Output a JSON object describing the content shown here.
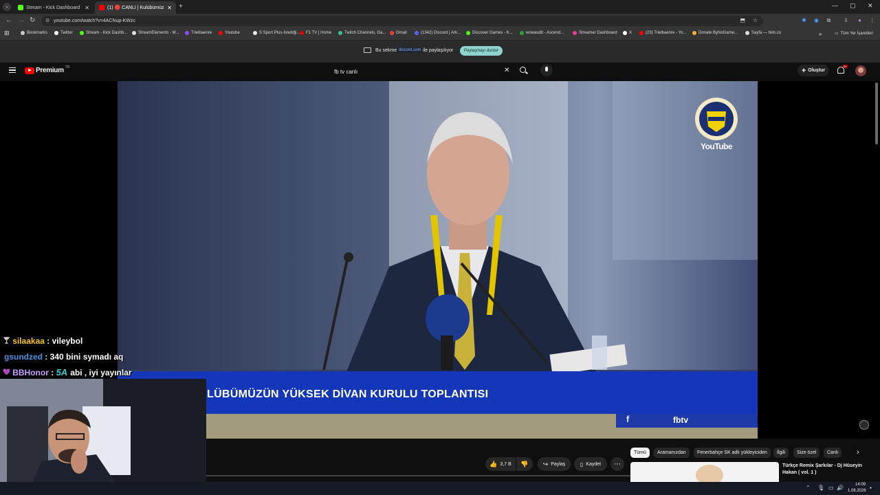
{
  "browser": {
    "tabs": [
      {
        "title": "Stream - Kick Dashboard",
        "active": false,
        "favicon_color": "#53fc18"
      },
      {
        "title": "(1) 🔴 CANLI | Kulübümüzü…",
        "active": true,
        "favicon_color": "#ff0000"
      }
    ],
    "new_tab_label": "+",
    "url": "youtube.com/watch?v=4ACNup-KWzc",
    "bookmarks": [
      {
        "label": "Bookmarks",
        "color": "#cccccc"
      },
      {
        "label": "Twitter",
        "color": "#ffffff"
      },
      {
        "label": "Stream - Kick Dashb...",
        "color": "#53fc18"
      },
      {
        "label": "StreamElements - M...",
        "color": "#dddddd"
      },
      {
        "label": "Trielbaenre",
        "color": "#9146ff"
      },
      {
        "label": "Youtube",
        "color": "#ff0000"
      },
      {
        "label": "S Sport Plus-İstediği...",
        "color": "#e8e8e8"
      },
      {
        "label": "F1 TV | Home",
        "color": "#e10600"
      },
      {
        "label": "Twitch Channels, Ga...",
        "color": "#3dbb9c"
      },
      {
        "label": "Gmail",
        "color": "#ea4335"
      },
      {
        "label": "(1342) Discord | Ark...",
        "color": "#5865f2"
      },
      {
        "label": "Discover Games - K...",
        "color": "#53fc18"
      },
      {
        "label": "wowaudit - Ascend...",
        "color": "#2ea043"
      },
      {
        "label": "Streamer Dashboard",
        "color": "#e040a0"
      },
      {
        "label": "X",
        "color": "#ffffff"
      },
      {
        "label": "(23) Trielbaenre - Yo...",
        "color": "#ff0000"
      },
      {
        "label": "Donate ByNoGame...",
        "color": "#f5b041"
      },
      {
        "label": "Sayfa — hiits.co",
        "color": "#dddddd"
      }
    ],
    "all_bookmarks_label": "Tüm Yer İşaretleri",
    "share_bar": {
      "prefix": "Bu sekme",
      "site": "discord.com",
      "suffix": "ile paylaşılıyor",
      "stop_button": "Paylaşmayı durdur"
    }
  },
  "youtube": {
    "brand": "Premium",
    "brand_sup": "TR",
    "search_query": "fb tv canlı",
    "create_label": "Oluştur",
    "notification_count": "9+"
  },
  "video": {
    "lower_third_title": "LÜBÜMÜZÜN YÜKSEK DİVAN KURULU TOPLANTISI",
    "channel_tag": "fbtv",
    "watermark_text": "YouTube"
  },
  "actions": {
    "likes": "3,7 B",
    "share": "Paylaş",
    "save": "Kaydet",
    "more": "⋯"
  },
  "chips": [
    {
      "label": "Tümü",
      "selected": true
    },
    {
      "label": "Aramanızdan",
      "selected": false
    },
    {
      "label": "Fenerbahçe SK adlı yükleyiciden",
      "selected": false
    },
    {
      "label": "İlgili",
      "selected": false
    },
    {
      "label": "Size özel",
      "selected": false
    },
    {
      "label": "Canlı",
      "selected": false
    }
  ],
  "recommendation": {
    "title": "Türkçe Remix Şarkılar - Dj Hüseyin Hakan ( vol. 1 )"
  },
  "chat": [
    {
      "user": "silaakaa",
      "message": "vileybol",
      "color": "#f5c518",
      "badge": "🍸"
    },
    {
      "user": "gsundzed",
      "message": "340 bini symadı aq",
      "color": "#4a90e2",
      "badge": ""
    },
    {
      "user": "BBHonor",
      "message": "abi , iyi yayınlar",
      "color": "#c9a0ff",
      "badge": "💜"
    }
  ],
  "chat_emote": "5A",
  "taskbar": {
    "time": "14:09",
    "date": "1.08.2026"
  }
}
